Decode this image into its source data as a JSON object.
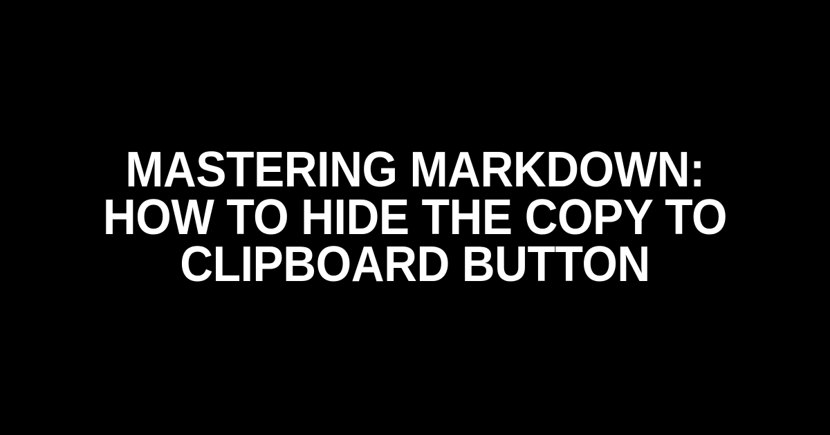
{
  "title": "Mastering Markdown: How to Hide the Copy to Clipboard Button"
}
